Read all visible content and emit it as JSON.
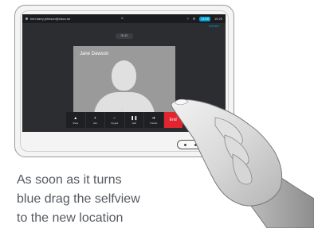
{
  "device": {
    "status_bar": {
      "uri": "tom.harry.johnson@cisco.se",
      "clock_pill": "11:59",
      "right_label": "10:25"
    },
    "sub_label": "Selfview",
    "call_timer": "00:12",
    "remote_participant": "Jane Dawson",
    "toolbar": [
      {
        "name": "share",
        "icon": "share-icon",
        "glyph": "▲",
        "label": "Share"
      },
      {
        "name": "add",
        "icon": "add-icon",
        "glyph": "+",
        "label": "Add"
      },
      {
        "name": "keypad",
        "icon": "keypad-icon",
        "glyph": "⁙",
        "label": "Keypad"
      },
      {
        "name": "hold",
        "icon": "pause-icon",
        "glyph": "❚❚",
        "label": "Hold"
      },
      {
        "name": "transfer",
        "icon": "transfer-icon",
        "glyph": "➔",
        "label": "Transfer"
      },
      {
        "name": "end",
        "icon": "",
        "glyph": "",
        "label": "End"
      }
    ],
    "colors": {
      "selfview_highlight": "#1f8fd1",
      "end_button": "#e2242f",
      "accent": "#00a0d1"
    }
  },
  "caption": {
    "line1": "As soon as it turns",
    "line2": "blue drag the selfview",
    "line3": "to the new location"
  }
}
